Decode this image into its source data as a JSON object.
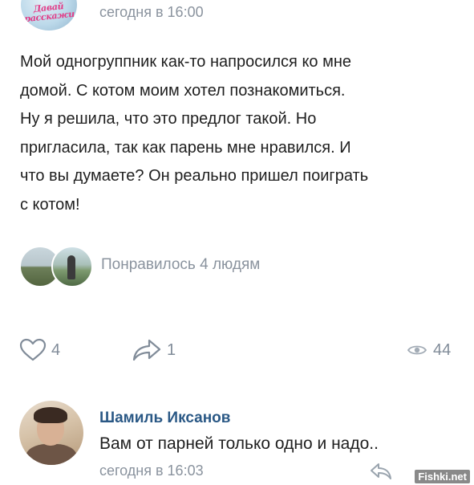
{
  "post": {
    "group_avatar_logo_line1": "Давай",
    "group_avatar_logo_line2": "расскажи",
    "time": "сегодня в 16:00",
    "text": "Мой одногруппник как-то напросился ко мне\nдомой. С котом моим хотел познакомиться.\nНу я решила, что это предлог такой. Но\nпригласила, так как парень мне нравился. И\nчто вы думаете? Он реально пришел поиграть\nс котом!",
    "likes_text": "Понравилось 4 людям"
  },
  "actions": {
    "like_count": "4",
    "share_count": "1",
    "views_count": "44"
  },
  "comment": {
    "author": "Шамиль Иксанов",
    "text": "Вам от парней только одно и надо..",
    "time": "сегодня в 16:03"
  },
  "watermark": "Fishki.net",
  "colors": {
    "secondary_text": "#8a939e",
    "icon": "#818c99",
    "author_link": "#2a5885"
  },
  "icons": {
    "like": "heart-icon",
    "share": "share-arrow-icon",
    "views": "eye-icon",
    "reply": "reply-arrow-icon"
  }
}
